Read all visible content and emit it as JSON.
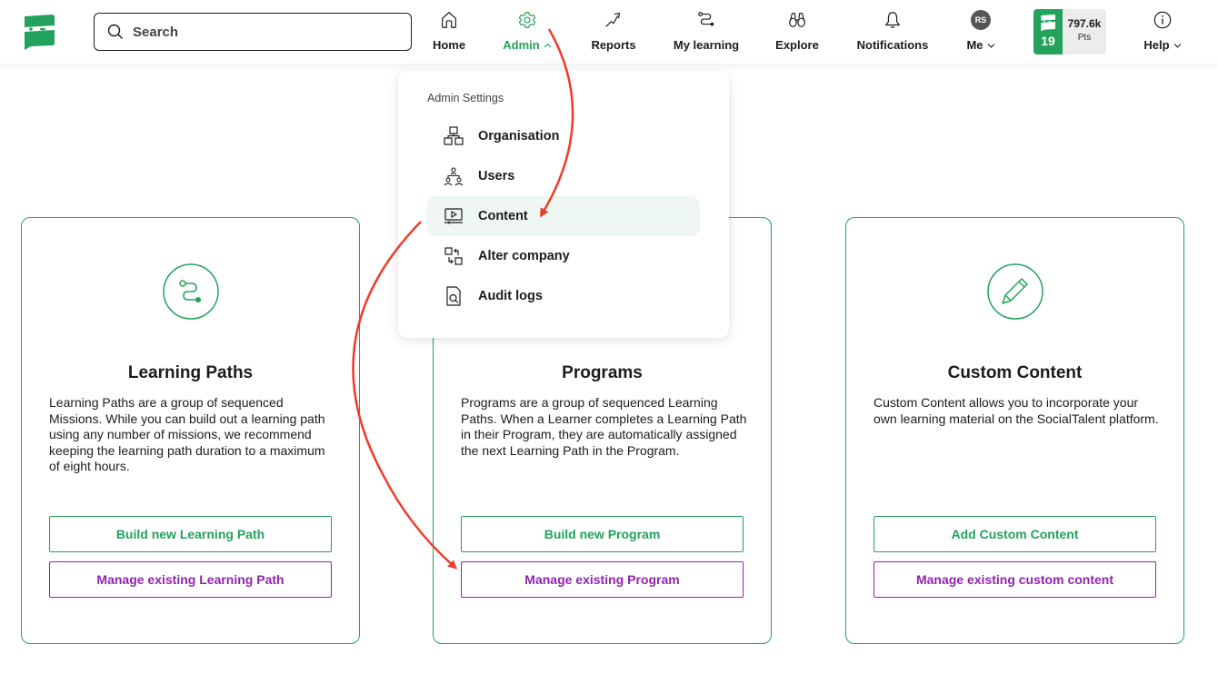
{
  "header": {
    "logo_name": "SocialTalent",
    "search": {
      "placeholder": "Search",
      "value": ""
    },
    "nav": [
      {
        "id": "home",
        "label": "Home",
        "icon": "home-icon"
      },
      {
        "id": "admin",
        "label": "Admin",
        "icon": "gear-icon",
        "active": true,
        "expanded": true
      },
      {
        "id": "reports",
        "label": "Reports",
        "icon": "trend-up-icon"
      },
      {
        "id": "my-learning",
        "label": "My learning",
        "icon": "path-icon"
      },
      {
        "id": "explore",
        "label": "Explore",
        "icon": "binoculars-icon"
      },
      {
        "id": "notifications",
        "label": "Notifications",
        "icon": "bell-icon"
      },
      {
        "id": "me",
        "label": "Me",
        "icon": "avatar",
        "avatar_initials": "RS"
      },
      {
        "id": "help",
        "label": "Help",
        "icon": "info-icon"
      }
    ],
    "points": {
      "level": "19",
      "value": "797.6k",
      "unit": "Pts"
    }
  },
  "admin_menu": {
    "title": "Admin Settings",
    "items": [
      {
        "label": "Organisation",
        "icon": "org-chart-icon"
      },
      {
        "label": "Users",
        "icon": "users-icon"
      },
      {
        "label": "Content",
        "icon": "video-screen-icon",
        "selected": true
      },
      {
        "label": "Alter company",
        "icon": "switch-icon"
      },
      {
        "label": "Audit logs",
        "icon": "document-search-icon"
      }
    ]
  },
  "cards": [
    {
      "title": "Learning Paths",
      "icon": "path-icon",
      "description": "Learning Paths are a group of sequenced Missions. While you can build out a learning path using any number of missions, we recommend keeping the learning path duration to a maximum of eight hours.",
      "primary_button": "Build new Learning Path",
      "secondary_button": "Manage existing Learning Path"
    },
    {
      "title": "Programs",
      "icon": "program-icon",
      "description": "Programs are a group of sequenced Learning Paths. When a Learner completes a Learning Path in their Program, they are automatically assigned the next Learning Path in the Program.",
      "primary_button": "Build new Program",
      "secondary_button": "Manage existing Program"
    },
    {
      "title": "Custom Content",
      "icon": "pencil-icon",
      "description": "Custom Content allows you to incorporate your own learning material on the SocialTalent platform.",
      "primary_button": "Add Custom Content",
      "secondary_button": "Manage existing custom content"
    }
  ],
  "colors": {
    "brand_green": "#23a25b",
    "secondary_purple": "#9024ac",
    "annotation_red": "#ef3b2c",
    "selected_bg": "#eef7f1"
  }
}
